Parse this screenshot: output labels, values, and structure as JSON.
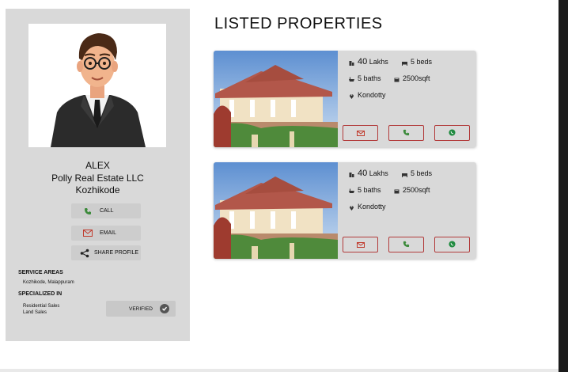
{
  "agent": {
    "name": "ALEX",
    "agency": "Polly Real Estate LLC",
    "city": "Kozhikode"
  },
  "actions": {
    "call_label": "CALL",
    "email_label": "EMAIL",
    "share_label": "SHARE PROFILE"
  },
  "service_areas": {
    "title": "SERVICE AREAS",
    "value": "Kozhikode, Malappuram"
  },
  "specialized_in": {
    "title": "SPECIALIZED IN",
    "items": [
      "Residential Sales",
      "Land Sales"
    ]
  },
  "verified_label": "VERIFIED",
  "listings": {
    "title": "LISTED PROPERTIES",
    "items": [
      {
        "price_value": "40",
        "price_unit": "Lakhs",
        "beds": "5 beds",
        "baths": "5 baths",
        "area": "2500sqft",
        "location": "Kondotty"
      },
      {
        "price_value": "40",
        "price_unit": "Lakhs",
        "beds": "5 beds",
        "baths": "5 baths",
        "area": "2500sqft",
        "location": "Kondotty"
      }
    ]
  },
  "icons": {
    "phone": "phone-icon",
    "mail": "mail-icon",
    "share": "share-icon",
    "whatsapp": "whatsapp-icon",
    "check": "check-circle-icon",
    "building": "building-icon",
    "bed": "bed-icon",
    "bath": "bath-icon",
    "area": "area-icon",
    "pin": "location-pin-icon"
  },
  "colors": {
    "phone": "#3b8a3a",
    "mail": "#c0392b",
    "whatsapp": "#1f8a3f",
    "button_border": "#b23b3b",
    "panel": "#d9d9d9"
  }
}
